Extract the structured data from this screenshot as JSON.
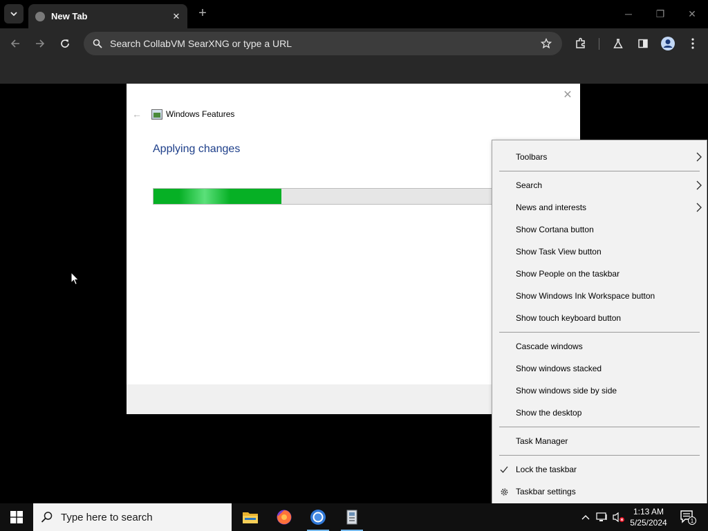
{
  "browser": {
    "tab": {
      "title": "New Tab",
      "close_glyph": "✕"
    },
    "new_tab_glyph": "+",
    "window_controls": {
      "minimize": "─",
      "restore": "❐",
      "close": "✕"
    },
    "omnibox_placeholder": "Search CollabVM SearXNG or type a URL",
    "icons": [
      "tab-search-icon",
      "back-icon",
      "forward-icon",
      "reload-icon",
      "search-icon",
      "star-icon",
      "extensions-icon",
      "labs-icon",
      "side-panel-icon",
      "profile-icon",
      "menu-icon"
    ]
  },
  "dialog": {
    "app_title": "Windows Features",
    "heading": "Applying changes",
    "progress_percent": 31,
    "close_glyph": "✕",
    "back_glyph": "←"
  },
  "context_menu": {
    "items": [
      {
        "label": "Toolbars",
        "submenu": true
      },
      {
        "label": "Search",
        "submenu": true
      },
      {
        "label": "News and interests",
        "submenu": true
      },
      {
        "label": "Show Cortana button"
      },
      {
        "label": "Show Task View button"
      },
      {
        "label": "Show People on the taskbar"
      },
      {
        "label": "Show Windows Ink Workspace button"
      },
      {
        "label": "Show touch keyboard button"
      },
      {
        "label": "Cascade windows"
      },
      {
        "label": "Show windows stacked"
      },
      {
        "label": "Show windows side by side"
      },
      {
        "label": "Show the desktop"
      },
      {
        "label": "Task Manager"
      },
      {
        "label": "Lock the taskbar",
        "checked": true
      },
      {
        "label": "Taskbar settings",
        "icon": "gear-icon"
      }
    ]
  },
  "taskbar": {
    "search_placeholder": "Type here to search",
    "apps": [
      "file-explorer-icon",
      "firefox-icon",
      "chrome-icon",
      "windows-features-icon"
    ],
    "clock_time": "1:13 AM",
    "clock_date": "5/25/2024",
    "notification_count": "1"
  },
  "colors": {
    "progress_green": "#06b025",
    "heading_blue": "#1e3f8a",
    "menu_bg": "#f2f2f2",
    "taskbar_bg": "#101010",
    "browser_toolbar": "#282828"
  }
}
